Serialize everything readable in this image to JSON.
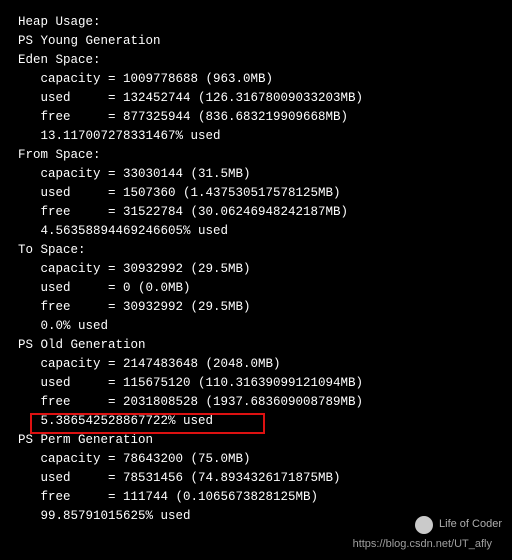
{
  "sections": {
    "title": "Heap Usage:",
    "young": "PS Young Generation",
    "eden": "Eden Space:",
    "eden_cap": "   capacity = 1009778688 (963.0MB)",
    "eden_used": "   used     = 132452744 (126.31678009033203MB)",
    "eden_free": "   free     = 877325944 (836.683219909668MB)",
    "eden_pct": "   13.117007278331467% used",
    "from": "From Space:",
    "from_cap": "   capacity = 33030144 (31.5MB)",
    "from_used": "   used     = 1507360 (1.437530517578125MB)",
    "from_free": "   free     = 31522784 (30.06246948242187MB)",
    "from_pct": "   4.56358894469246605% used",
    "to": "To Space:",
    "to_cap": "   capacity = 30932992 (29.5MB)",
    "to_used": "   used     = 0 (0.0MB)",
    "to_free": "   free     = 30932992 (29.5MB)",
    "to_pct": "   0.0% used",
    "old": "PS Old Generation",
    "old_cap": "   capacity = 2147483648 (2048.0MB)",
    "old_used": "   used     = 115675120 (110.31639099121094MB)",
    "old_free": "   free     = 2031808528 (1937.683609008789MB)",
    "old_pct": "   5.386542528867722% used",
    "perm": "PS Perm Generation",
    "perm_cap": "   capacity = 78643200 (75.0MB)",
    "perm_used": "   used     = 78531456 (74.8934326171875MB)",
    "perm_free": "   free     = 111744 (0.1065673828125MB)",
    "perm_pct": "   99.85791015625% used"
  },
  "overlay": {
    "brand": "Life of Coder",
    "url": "https://blog.csdn.net/UT_afly"
  }
}
